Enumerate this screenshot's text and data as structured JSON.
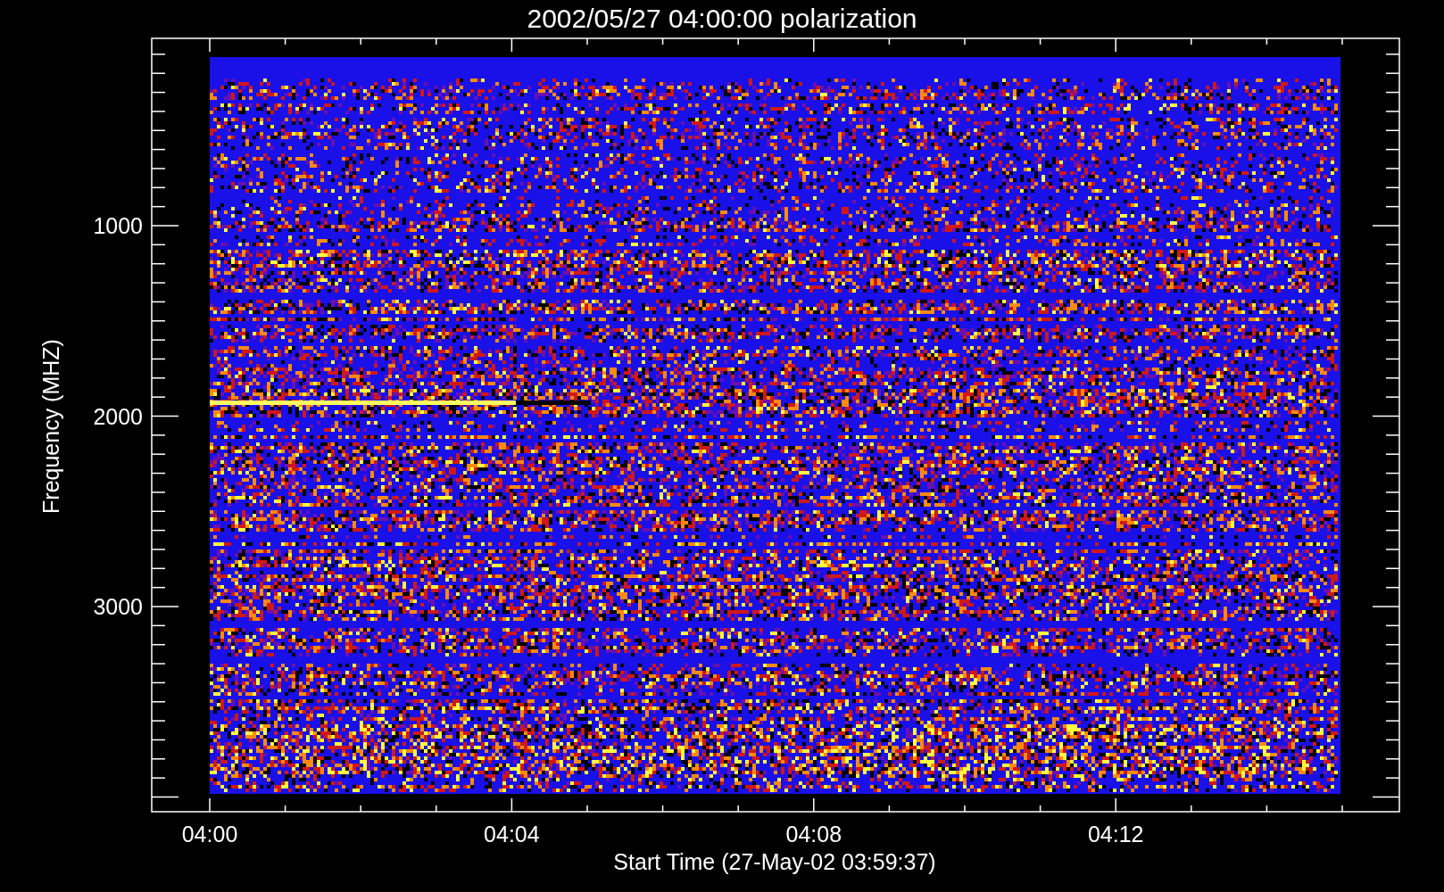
{
  "plot": {
    "title": "2002/05/27 04:00:00 polarization",
    "ylabel": "Frequency (MHZ)",
    "xlabel": "Start Time (27-May-02 03:59:37)",
    "yticks": [
      {
        "label": "1000"
      },
      {
        "label": "2000"
      },
      {
        "label": "3000"
      }
    ],
    "xticks": [
      {
        "label": "04:00"
      },
      {
        "label": "04:04"
      },
      {
        "label": "04:08"
      },
      {
        "label": "04:12"
      }
    ]
  }
}
